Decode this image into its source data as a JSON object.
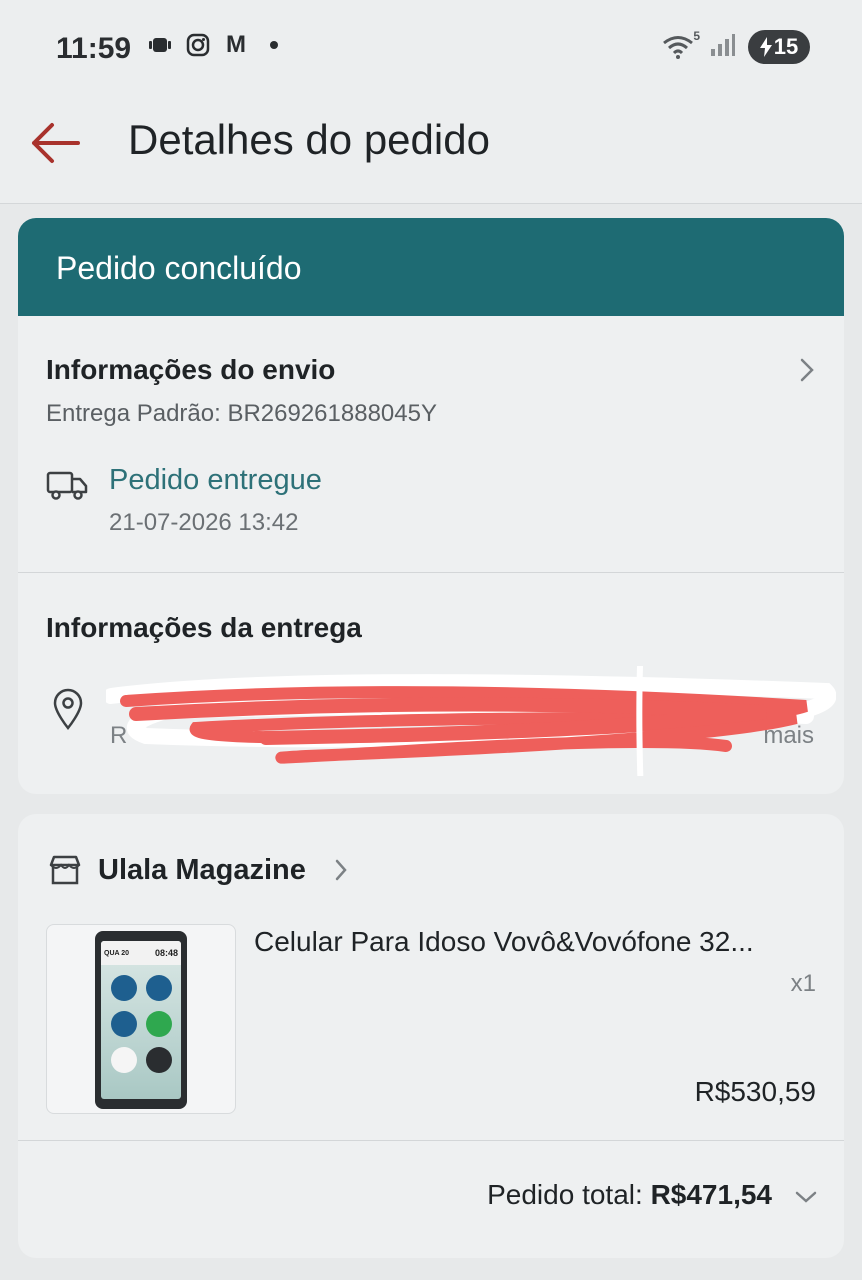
{
  "status_bar": {
    "time": "11:59",
    "notification_icons": [
      "voicemail-icon",
      "instagram-icon",
      "gmail-icon",
      "dot-icon"
    ],
    "gmail_glyph": "M",
    "wifi_label": "5",
    "battery_level": "15"
  },
  "header": {
    "title": "Detalhes do pedido"
  },
  "order": {
    "status_banner": "Pedido concluído",
    "shipping": {
      "title": "Informações do envio",
      "method_tracking": "Entrega Padrão: BR269261888045Y",
      "status": "Pedido entregue",
      "timestamp": "21-07-2026 13:42"
    },
    "delivery": {
      "title": "Informações da entrega",
      "initial": "R",
      "more_link": "mais"
    },
    "store": {
      "name": "Ulala Magazine"
    },
    "product": {
      "name": "Celular Para Idoso Vovô&Vovófone 32...",
      "quantity": "x1",
      "price": "R$530,59",
      "thumb_day": "QUA 20",
      "thumb_clock": "08:48"
    },
    "total": {
      "label": "Pedido total:",
      "value": "R$471,54"
    }
  },
  "colors": {
    "banner": "#1e6b73",
    "accent_text": "#2d7178",
    "back_arrow": "#a8322c",
    "redaction": "#ee5f5b"
  }
}
